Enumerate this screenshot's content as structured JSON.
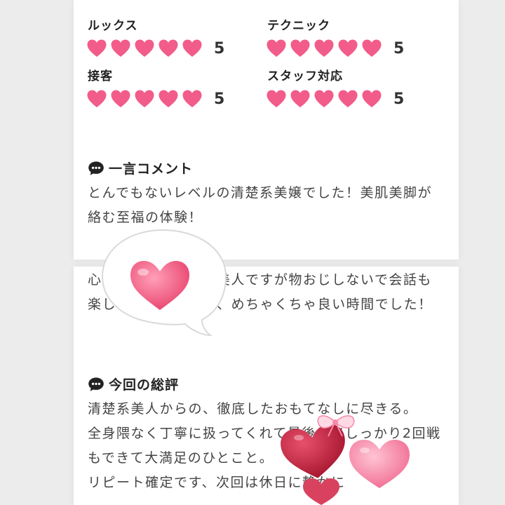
{
  "ratings": [
    {
      "label": "ルックス",
      "score": "5",
      "hearts": 5
    },
    {
      "label": "テクニック",
      "score": "5",
      "hearts": 5
    },
    {
      "label": "接客",
      "score": "5",
      "hearts": 5
    },
    {
      "label": "スタッフ対応",
      "score": "5",
      "hearts": 5
    }
  ],
  "comment": {
    "heading": "一言コメント",
    "paragraphs": [
      "とんでもないレベルの清楚系美嬢でした！美肌美脚が絡む至福の体験！",
      "心配していた清楚系美人ですが物おじしないで会話も楽しめて満足できる、めちゃくちゃ良い時間でした！"
    ]
  },
  "review": {
    "heading": "今回の総評",
    "paragraphs": [
      "清楚系美人からの、徹底したおもてなしに尽きる。",
      "全身隈なく丁寧に扱ってくれて最後までしっかり2回戦もできて大満足のひとこと。",
      "リピート確定です、次回は休日に静かに"
    ]
  },
  "colors": {
    "heart": "#f25c8a",
    "page_bg": "#ececec",
    "card_bg": "#ffffff"
  },
  "icons": [
    "heart-icon",
    "speech-bubble-icon",
    "heart-bubble-sticker",
    "heart-cluster-sticker"
  ]
}
